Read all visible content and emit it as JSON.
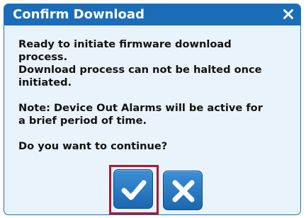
{
  "dialog": {
    "title": "Confirm Download",
    "message_lines": [
      "Ready to initiate firmware download",
      "process.",
      "Download process can not be halted once",
      "initiated."
    ],
    "note_lines": [
      "Note: Device Out Alarms will be active for",
      "a brief period of time."
    ],
    "question": "Do you want to continue?",
    "icons": {
      "close": "close-icon",
      "confirm": "checkmark-icon",
      "cancel": "x-icon"
    },
    "colors": {
      "titlebar": "#1b6db7",
      "background": "#e9f3fb",
      "button": "#2a7cc7",
      "selection_highlight": "#b0162c"
    }
  }
}
